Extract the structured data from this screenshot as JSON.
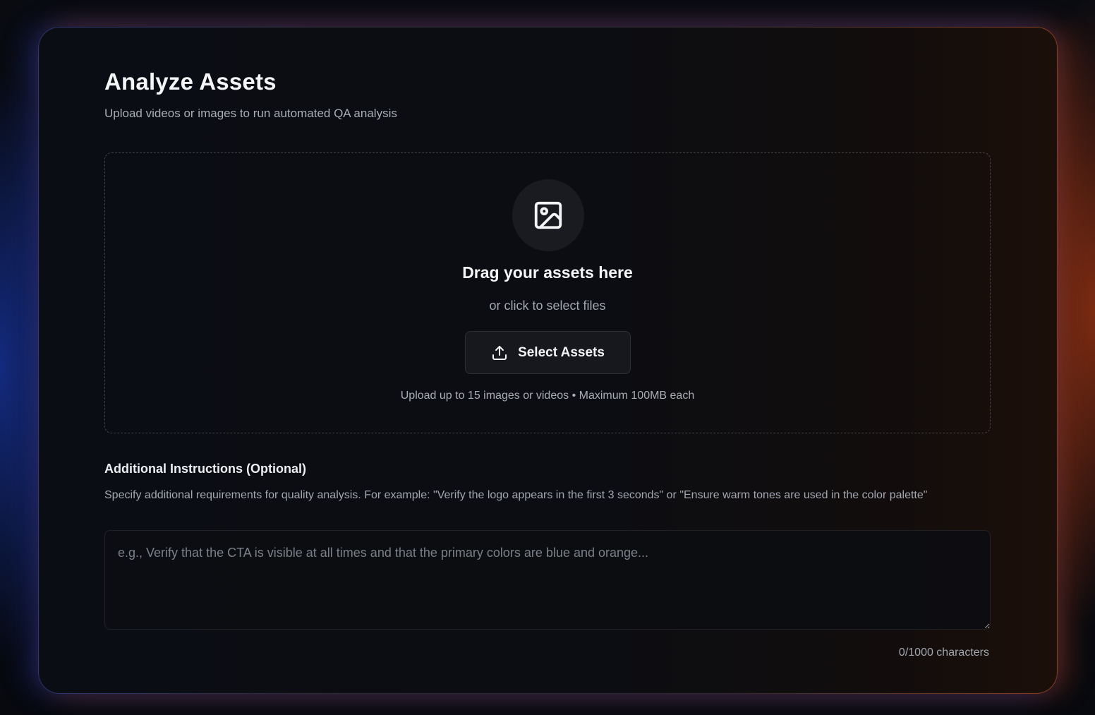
{
  "page": {
    "title": "Analyze Assets",
    "subtitle": "Upload videos or images to run automated QA analysis"
  },
  "dropzone": {
    "icon": "image-icon",
    "title": "Drag your assets here",
    "subtitle": "or click to select files",
    "button_label": "Select Assets",
    "button_icon": "upload-icon",
    "note": "Upload up to 15 images or videos • Maximum 100MB each"
  },
  "instructions": {
    "label": "Additional Instructions (Optional)",
    "help": "Specify additional requirements for quality analysis. For example: \"Verify the logo appears in the first 3 seconds\" or \"Ensure warm tones are used in the color palette\"",
    "placeholder": "e.g., Verify that the CTA is visible at all times and that the primary colors are blue and orange...",
    "value": "",
    "char_count": "0/1000 characters"
  },
  "colors": {
    "accent_left": "#2a50e6",
    "accent_right": "#e0561c",
    "card_bg": "#0c0d12"
  }
}
